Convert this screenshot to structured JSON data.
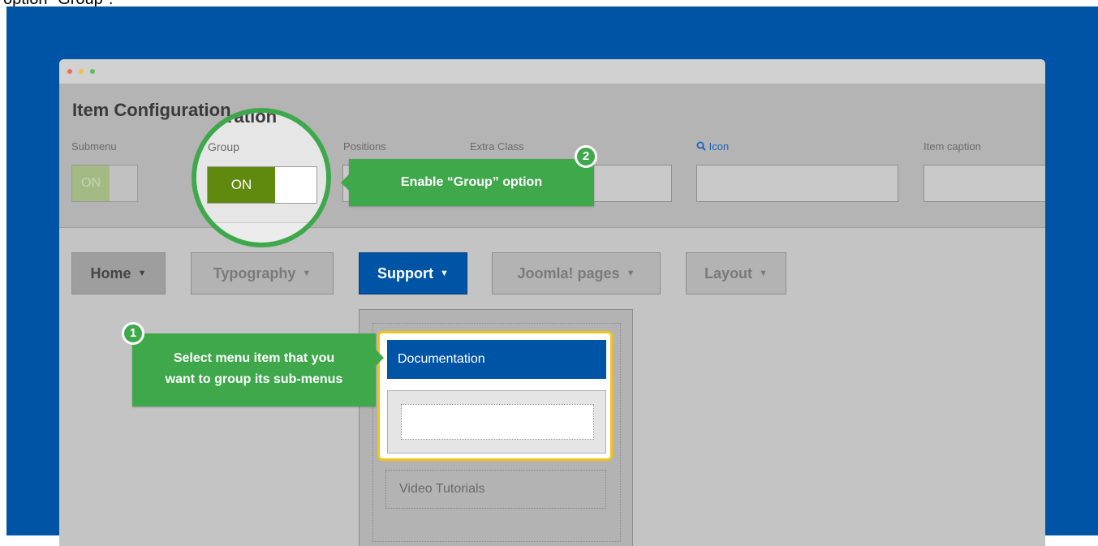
{
  "caption_fragment": "option \"Group\".",
  "config": {
    "title": "Item Configuration",
    "labels": {
      "submenu": "Submenu",
      "group": "Group",
      "positions": "Positions",
      "extra_class": "Extra Class",
      "icon": "Icon",
      "item_caption": "Item caption"
    },
    "submenu_toggle": "ON",
    "group_toggle": "ON"
  },
  "menu": {
    "items": [
      "Home",
      "Typography",
      "Support",
      "Joomla! pages",
      "Layout"
    ],
    "active": "Support"
  },
  "dropdown": {
    "documentation": "Documentation",
    "video": "Video Tutorials"
  },
  "callouts": {
    "step1_number": "1",
    "step1_line1": "Select menu item that you",
    "step1_line2": "want to group its sub-menus",
    "step2_number": "2",
    "step2_text": "Enable “Group” option"
  },
  "colors": {
    "background": "#0054a6",
    "callout_green": "#3ea84b",
    "toggle_on": "#5f8a0e",
    "highlight_border": "#f2c315"
  },
  "icons": {
    "search": "search-icon"
  }
}
